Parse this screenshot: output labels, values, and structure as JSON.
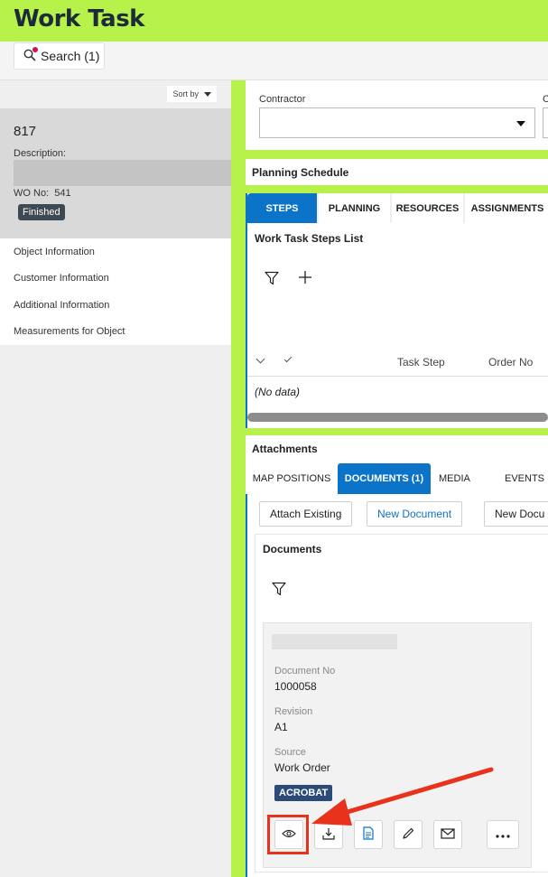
{
  "title": "Work Task",
  "toolbar": {
    "search_label": "Search (1)"
  },
  "left": {
    "sort_label": "Sort by",
    "record": {
      "number": "817",
      "description_label": "Description:",
      "wo_label": "WO No:",
      "wo_value": "541",
      "status": "Finished"
    },
    "nav": [
      "Object Information",
      "Customer Information",
      "Additional Information",
      "Measurements for Object"
    ]
  },
  "form": {
    "contractor_label": "Contractor",
    "next_label": "C"
  },
  "planning": {
    "title": "Planning Schedule"
  },
  "steps": {
    "tabs": [
      "STEPS",
      "PLANNING",
      "RESOURCES",
      "ASSIGNMENTS"
    ],
    "list_title": "Work Task Steps List",
    "columns": [
      "Task Step",
      "Order No"
    ],
    "empty": "(No data)"
  },
  "attachments": {
    "title": "Attachments",
    "tabs": [
      "MAP POSITIONS",
      "DOCUMENTS (1)",
      "MEDIA",
      "EVENTS"
    ],
    "buttons": {
      "attach_existing": "Attach Existing",
      "new_document": "New Document",
      "new_docu": "New Docu"
    },
    "documents_title": "Documents",
    "document": {
      "doc_no_label": "Document No",
      "doc_no": "1000058",
      "revision_label": "Revision",
      "revision": "A1",
      "source_label": "Source",
      "source": "Work Order",
      "format": "ACROBAT"
    },
    "actions": [
      "eye-icon",
      "download-icon",
      "document-icon",
      "pencil-icon",
      "mail-icon",
      "more-icon"
    ]
  },
  "colors": {
    "header_green": "#b6f24a",
    "accent_blue": "#0b73c8",
    "annotation_red": "#e8321c"
  }
}
